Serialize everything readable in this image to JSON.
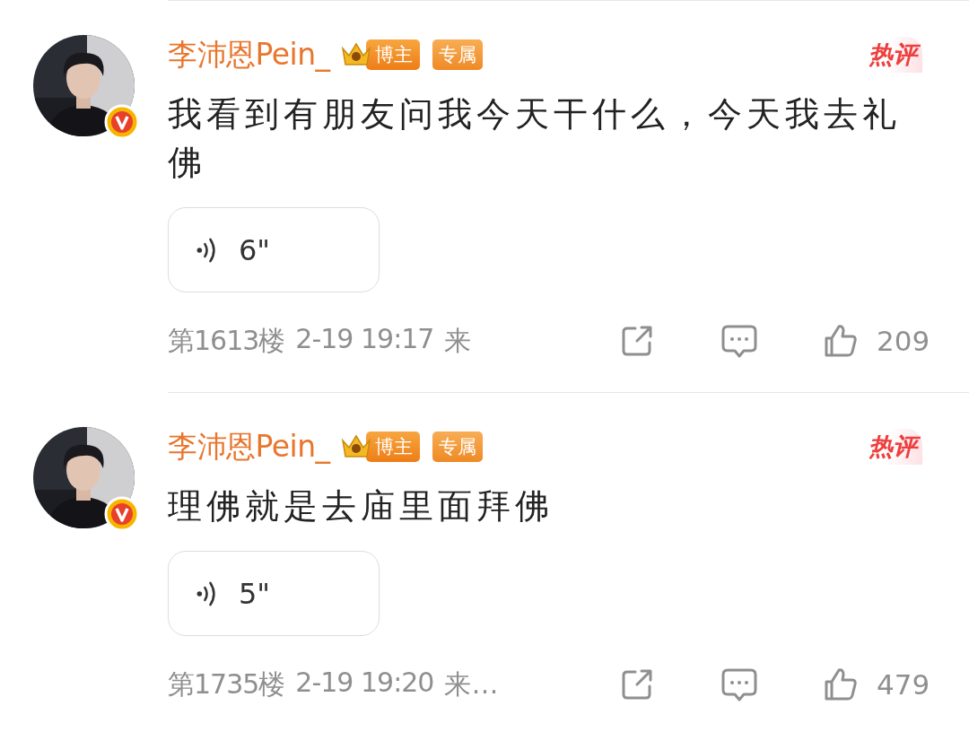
{
  "comments": [
    {
      "name": "李沛恩Pein_",
      "verified": true,
      "badges": [
        {
          "kind": "crown",
          "text": "博主"
        },
        {
          "kind": "plain",
          "text": "专属"
        }
      ],
      "hot_label": "热评",
      "text": "我看到有朋友问我今天干什么，今天我去礼佛",
      "voice": {
        "duration": "6\""
      },
      "floor": "第1613楼",
      "time": "2-19 19:17",
      "source": "来",
      "source_faded": true,
      "likes": "209"
    },
    {
      "name": "李沛恩Pein_",
      "verified": true,
      "badges": [
        {
          "kind": "crown",
          "text": "博主"
        },
        {
          "kind": "plain",
          "text": "专属"
        }
      ],
      "hot_label": "热评",
      "text": "理佛就是去庙里面拜佛",
      "voice": {
        "duration": "5\""
      },
      "floor": "第1735楼",
      "time": "2-19 19:20",
      "source": "来…",
      "source_faded": false,
      "likes": "479"
    }
  ]
}
